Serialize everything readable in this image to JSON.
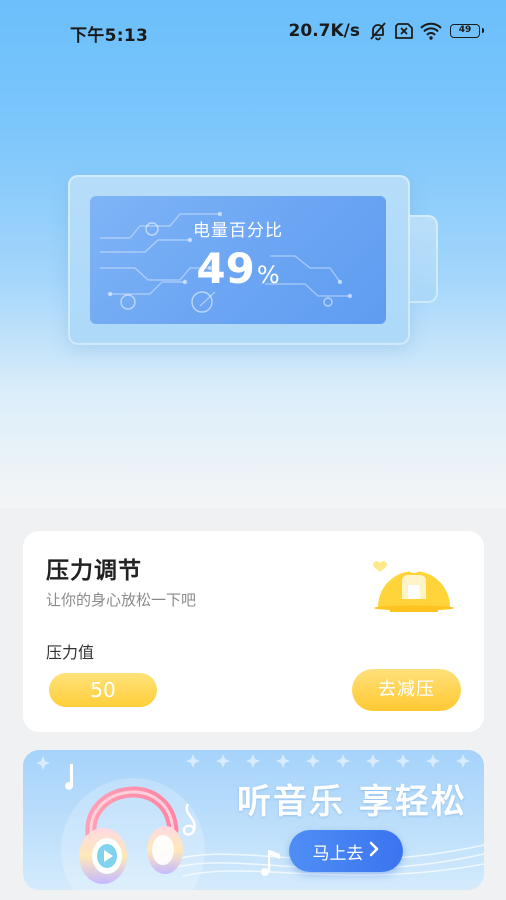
{
  "status_bar": {
    "time": "下午5:13",
    "net_speed": "20.7K/s",
    "icons": [
      "mute-bell-icon",
      "sim-off-icon",
      "wifi-icon",
      "battery-icon"
    ],
    "battery_level": "49"
  },
  "battery_panel": {
    "label": "电量百分比",
    "value": "49",
    "unit": "%",
    "level_fraction": 0.49
  },
  "stress_card": {
    "title": "压力调节",
    "subtitle": "让你的身心放松一下吧",
    "value_label": "压力值",
    "value": "50",
    "button_label": "去减压",
    "illustration_icon": "relaxing-person-icon",
    "accent_color": "#ffcf3a"
  },
  "music_banner": {
    "title": "听音乐 享轻松",
    "button_label": "马上去",
    "button_icon": "chevron-right-icon",
    "illustration_icon": "headphones-icon",
    "accent_color": "#3b74ef"
  }
}
